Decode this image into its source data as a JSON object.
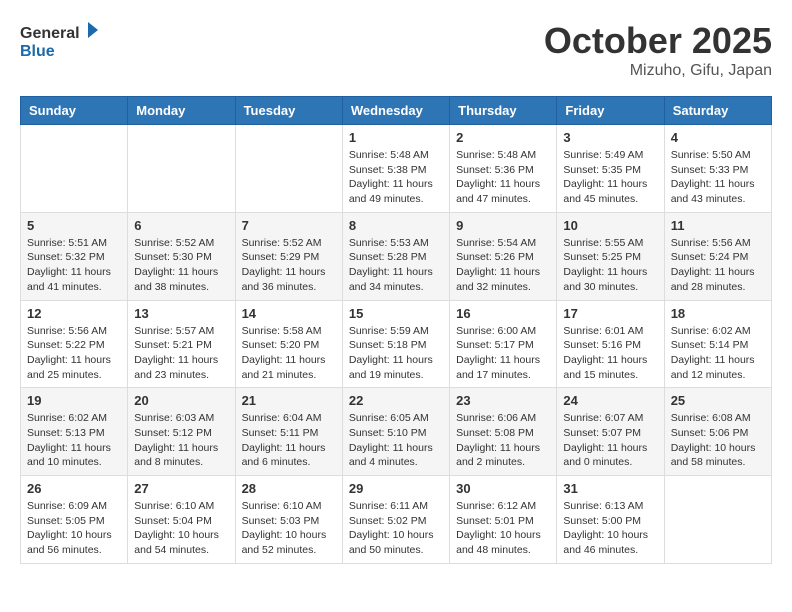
{
  "header": {
    "logo_line1": "General",
    "logo_line2": "Blue",
    "month": "October 2025",
    "location": "Mizuho, Gifu, Japan"
  },
  "weekdays": [
    "Sunday",
    "Monday",
    "Tuesday",
    "Wednesday",
    "Thursday",
    "Friday",
    "Saturday"
  ],
  "weeks": [
    [
      {
        "day": "",
        "info": ""
      },
      {
        "day": "",
        "info": ""
      },
      {
        "day": "",
        "info": ""
      },
      {
        "day": "1",
        "info": "Sunrise: 5:48 AM\nSunset: 5:38 PM\nDaylight: 11 hours\nand 49 minutes."
      },
      {
        "day": "2",
        "info": "Sunrise: 5:48 AM\nSunset: 5:36 PM\nDaylight: 11 hours\nand 47 minutes."
      },
      {
        "day": "3",
        "info": "Sunrise: 5:49 AM\nSunset: 5:35 PM\nDaylight: 11 hours\nand 45 minutes."
      },
      {
        "day": "4",
        "info": "Sunrise: 5:50 AM\nSunset: 5:33 PM\nDaylight: 11 hours\nand 43 minutes."
      }
    ],
    [
      {
        "day": "5",
        "info": "Sunrise: 5:51 AM\nSunset: 5:32 PM\nDaylight: 11 hours\nand 41 minutes."
      },
      {
        "day": "6",
        "info": "Sunrise: 5:52 AM\nSunset: 5:30 PM\nDaylight: 11 hours\nand 38 minutes."
      },
      {
        "day": "7",
        "info": "Sunrise: 5:52 AM\nSunset: 5:29 PM\nDaylight: 11 hours\nand 36 minutes."
      },
      {
        "day": "8",
        "info": "Sunrise: 5:53 AM\nSunset: 5:28 PM\nDaylight: 11 hours\nand 34 minutes."
      },
      {
        "day": "9",
        "info": "Sunrise: 5:54 AM\nSunset: 5:26 PM\nDaylight: 11 hours\nand 32 minutes."
      },
      {
        "day": "10",
        "info": "Sunrise: 5:55 AM\nSunset: 5:25 PM\nDaylight: 11 hours\nand 30 minutes."
      },
      {
        "day": "11",
        "info": "Sunrise: 5:56 AM\nSunset: 5:24 PM\nDaylight: 11 hours\nand 28 minutes."
      }
    ],
    [
      {
        "day": "12",
        "info": "Sunrise: 5:56 AM\nSunset: 5:22 PM\nDaylight: 11 hours\nand 25 minutes."
      },
      {
        "day": "13",
        "info": "Sunrise: 5:57 AM\nSunset: 5:21 PM\nDaylight: 11 hours\nand 23 minutes."
      },
      {
        "day": "14",
        "info": "Sunrise: 5:58 AM\nSunset: 5:20 PM\nDaylight: 11 hours\nand 21 minutes."
      },
      {
        "day": "15",
        "info": "Sunrise: 5:59 AM\nSunset: 5:18 PM\nDaylight: 11 hours\nand 19 minutes."
      },
      {
        "day": "16",
        "info": "Sunrise: 6:00 AM\nSunset: 5:17 PM\nDaylight: 11 hours\nand 17 minutes."
      },
      {
        "day": "17",
        "info": "Sunrise: 6:01 AM\nSunset: 5:16 PM\nDaylight: 11 hours\nand 15 minutes."
      },
      {
        "day": "18",
        "info": "Sunrise: 6:02 AM\nSunset: 5:14 PM\nDaylight: 11 hours\nand 12 minutes."
      }
    ],
    [
      {
        "day": "19",
        "info": "Sunrise: 6:02 AM\nSunset: 5:13 PM\nDaylight: 11 hours\nand 10 minutes."
      },
      {
        "day": "20",
        "info": "Sunrise: 6:03 AM\nSunset: 5:12 PM\nDaylight: 11 hours\nand 8 minutes."
      },
      {
        "day": "21",
        "info": "Sunrise: 6:04 AM\nSunset: 5:11 PM\nDaylight: 11 hours\nand 6 minutes."
      },
      {
        "day": "22",
        "info": "Sunrise: 6:05 AM\nSunset: 5:10 PM\nDaylight: 11 hours\nand 4 minutes."
      },
      {
        "day": "23",
        "info": "Sunrise: 6:06 AM\nSunset: 5:08 PM\nDaylight: 11 hours\nand 2 minutes."
      },
      {
        "day": "24",
        "info": "Sunrise: 6:07 AM\nSunset: 5:07 PM\nDaylight: 11 hours\nand 0 minutes."
      },
      {
        "day": "25",
        "info": "Sunrise: 6:08 AM\nSunset: 5:06 PM\nDaylight: 10 hours\nand 58 minutes."
      }
    ],
    [
      {
        "day": "26",
        "info": "Sunrise: 6:09 AM\nSunset: 5:05 PM\nDaylight: 10 hours\nand 56 minutes."
      },
      {
        "day": "27",
        "info": "Sunrise: 6:10 AM\nSunset: 5:04 PM\nDaylight: 10 hours\nand 54 minutes."
      },
      {
        "day": "28",
        "info": "Sunrise: 6:10 AM\nSunset: 5:03 PM\nDaylight: 10 hours\nand 52 minutes."
      },
      {
        "day": "29",
        "info": "Sunrise: 6:11 AM\nSunset: 5:02 PM\nDaylight: 10 hours\nand 50 minutes."
      },
      {
        "day": "30",
        "info": "Sunrise: 6:12 AM\nSunset: 5:01 PM\nDaylight: 10 hours\nand 48 minutes."
      },
      {
        "day": "31",
        "info": "Sunrise: 6:13 AM\nSunset: 5:00 PM\nDaylight: 10 hours\nand 46 minutes."
      },
      {
        "day": "",
        "info": ""
      }
    ]
  ]
}
